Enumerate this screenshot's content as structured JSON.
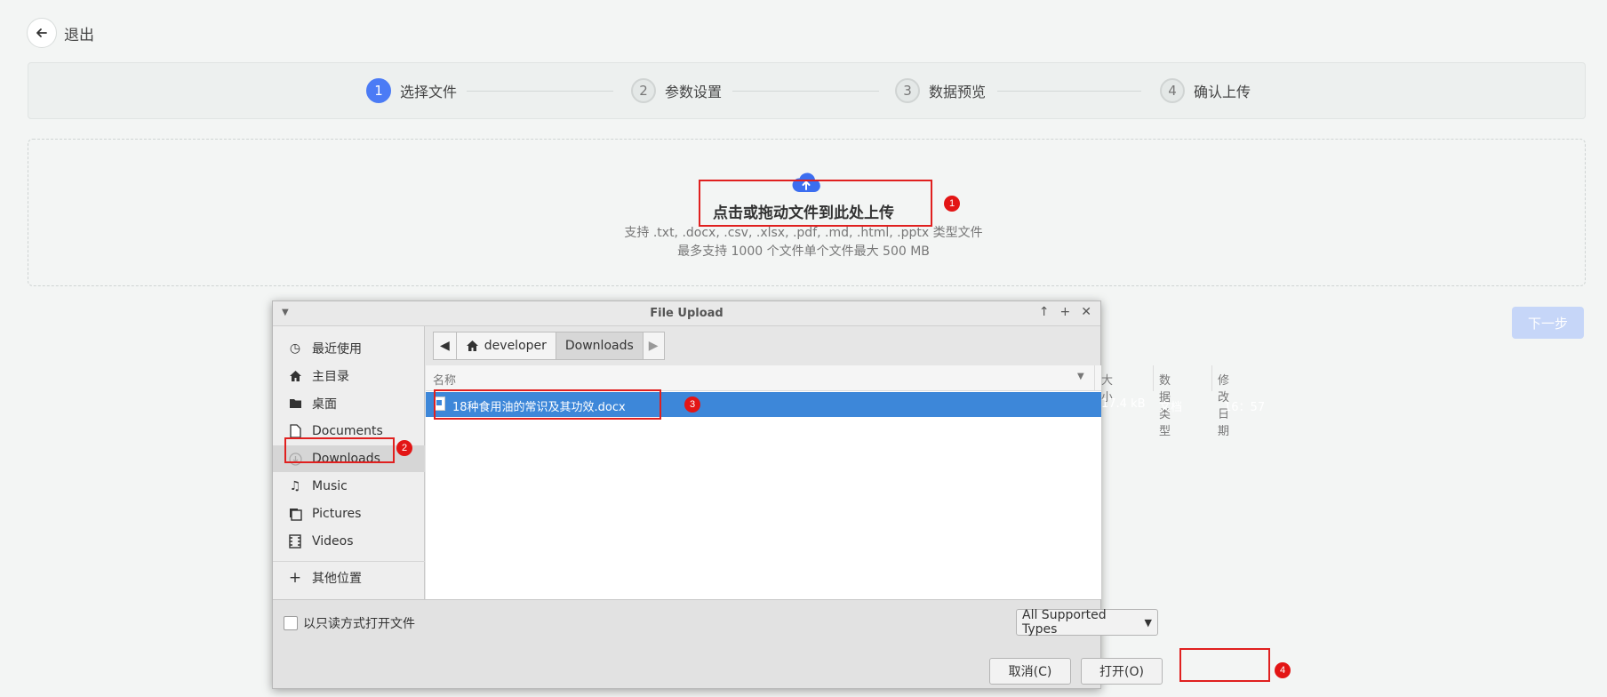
{
  "header": {
    "exit_label": "退出"
  },
  "steps": [
    {
      "num": "1",
      "label": "选择文件"
    },
    {
      "num": "2",
      "label": "参数设置"
    },
    {
      "num": "3",
      "label": "数据预览"
    },
    {
      "num": "4",
      "label": "确认上传"
    }
  ],
  "upload": {
    "title": "点击或拖动文件到此处上传",
    "supported": "支持 .txt, .docx, .csv, .xlsx, .pdf, .md, .html, .pptx 类型文件",
    "limits": "最多支持 1000 个文件单个文件最大 500 MB"
  },
  "next_label": "下一步",
  "dialog": {
    "title": "File Upload",
    "sidebar": [
      {
        "label": "最近使用",
        "icon": "recent-icon"
      },
      {
        "label": "主目录",
        "icon": "home-icon"
      },
      {
        "label": "桌面",
        "icon": "folder-icon"
      },
      {
        "label": "Documents",
        "icon": "document-icon"
      },
      {
        "label": "Downloads",
        "icon": "download-icon"
      },
      {
        "label": "Music",
        "icon": "music-icon"
      },
      {
        "label": "Pictures",
        "icon": "pictures-icon"
      },
      {
        "label": "Videos",
        "icon": "video-icon"
      },
      {
        "label": "其他位置",
        "icon": "plus-icon"
      }
    ],
    "path": [
      "developer",
      "Downloads"
    ],
    "columns": {
      "name": "名称",
      "size": "大小",
      "type": "数据类型",
      "modified": "修改日期"
    },
    "files": [
      {
        "name": "18种食用油的常识及其功效.docx",
        "size": "17.4 kB",
        "type": "文档",
        "modified": "16：57"
      }
    ],
    "readonly_label": "以只读方式打开文件",
    "filter_label": "All Supported Types",
    "cancel_label": "取消(C)",
    "open_label": "打开(O)"
  },
  "annotations": [
    "1",
    "2",
    "3",
    "4"
  ],
  "colors": {
    "accent": "#4b7bf5",
    "highlight": "#e0201f",
    "selection": "#3d87d9"
  }
}
